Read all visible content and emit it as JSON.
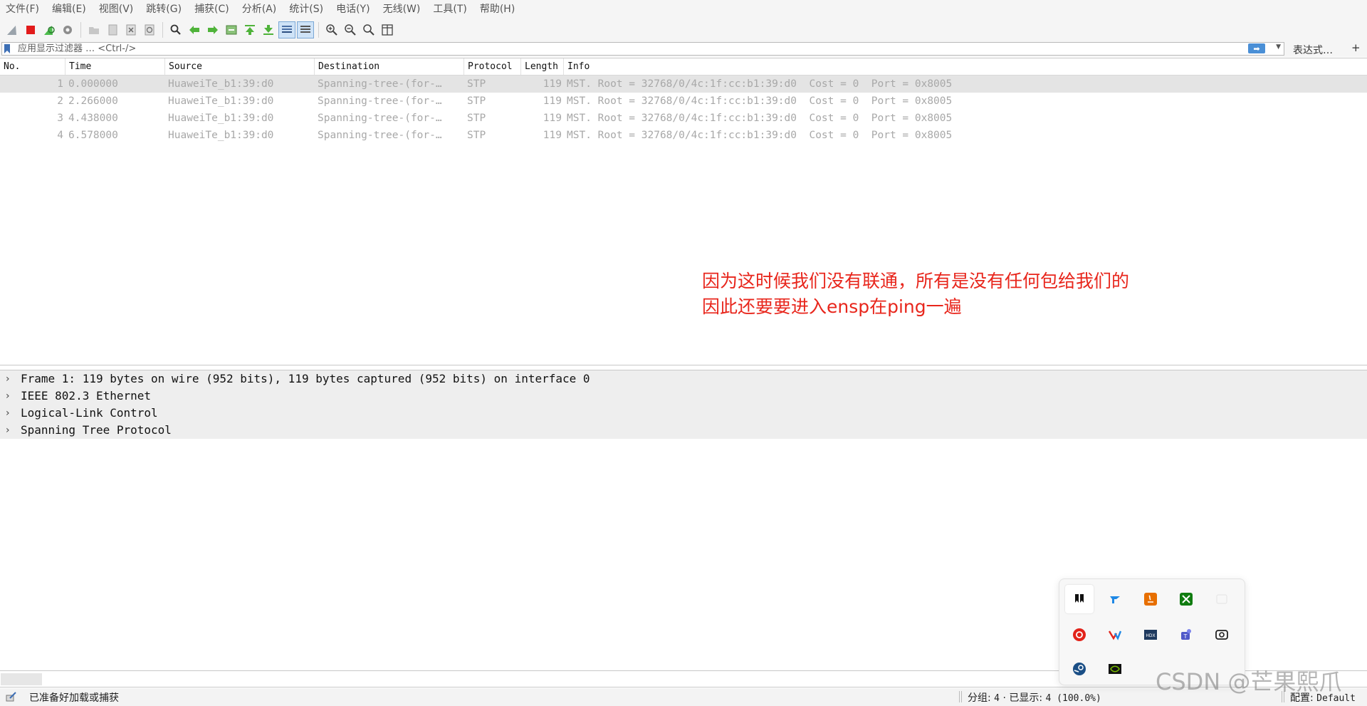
{
  "menu": [
    "文件(F)",
    "编辑(E)",
    "视图(V)",
    "跳转(G)",
    "捕获(C)",
    "分析(A)",
    "统计(S)",
    "电话(Y)",
    "无线(W)",
    "工具(T)",
    "帮助(H)"
  ],
  "toolbar": {
    "icons": [
      "shark-fin-start-icon",
      "stop-capture-icon",
      "restart-capture-icon",
      "capture-options-icon",
      "open-file-icon",
      "save-file-icon",
      "close-file-icon",
      "reload-file-icon",
      "find-packet-icon",
      "go-back-icon",
      "go-forward-icon",
      "go-to-packet-icon",
      "go-first-icon",
      "go-last-icon",
      "auto-scroll-icon",
      "colorize-icon",
      "zoom-in-icon",
      "zoom-out-icon",
      "zoom-normal-icon",
      "resize-columns-icon"
    ]
  },
  "filter": {
    "placeholder": "应用显示过滤器 … <Ctrl-/>",
    "expression_label": "表达式…",
    "add_label": "+"
  },
  "packet_list": {
    "columns": [
      "No.",
      "Time",
      "Source",
      "Destination",
      "Protocol",
      "Length",
      "Info"
    ],
    "rows": [
      {
        "no": "1",
        "time": "0.000000",
        "source": "HuaweiTe_b1:39:d0",
        "destination": "Spanning-tree-(for-…",
        "protocol": "STP",
        "length": "119",
        "info": "MST. Root = 32768/0/4c:1f:cc:b1:39:d0  Cost = 0  Port = 0x8005"
      },
      {
        "no": "2",
        "time": "2.266000",
        "source": "HuaweiTe_b1:39:d0",
        "destination": "Spanning-tree-(for-…",
        "protocol": "STP",
        "length": "119",
        "info": "MST. Root = 32768/0/4c:1f:cc:b1:39:d0  Cost = 0  Port = 0x8005"
      },
      {
        "no": "3",
        "time": "4.438000",
        "source": "HuaweiTe_b1:39:d0",
        "destination": "Spanning-tree-(for-…",
        "protocol": "STP",
        "length": "119",
        "info": "MST. Root = 32768/0/4c:1f:cc:b1:39:d0  Cost = 0  Port = 0x8005"
      },
      {
        "no": "4",
        "time": "6.578000",
        "source": "HuaweiTe_b1:39:d0",
        "destination": "Spanning-tree-(for-…",
        "protocol": "STP",
        "length": "119",
        "info": "MST. Root = 32768/0/4c:1f:cc:b1:39:d0  Cost = 0  Port = 0x8005"
      }
    ]
  },
  "annotation": {
    "line1": "因为这时候我们没有联通，所有是没有任何包给我们的",
    "line2": "因此还要要进入ensp在ping一遍",
    "color": "#e8261c"
  },
  "details": [
    "Frame 1: 119 bytes on wire (952 bits), 119 bytes captured (952 bits) on interface 0",
    "IEEE 802.3 Ethernet",
    "Logical-Link Control",
    "Spanning Tree Protocol"
  ],
  "status": {
    "ready": "已准备好加载或捕获",
    "packets_label": "分组:",
    "packets_value": "4",
    "separator": "·",
    "displayed_label": "已显示:",
    "displayed_value": "4 (100.0%)",
    "profile_label": "配置:",
    "profile_value": "Default"
  },
  "tray": {
    "icons": [
      "bookmark-app-icon",
      "feishu-icon",
      "java-icon",
      "xbox-icon",
      "placeholder-icon",
      "netease-music-icon",
      "vmware-icon",
      "hdx-icon",
      "teams-icon",
      "screenshot-app-icon",
      "steam-icon",
      "nvidia-icon"
    ]
  },
  "watermark": "CSDN @芒果熙爪"
}
